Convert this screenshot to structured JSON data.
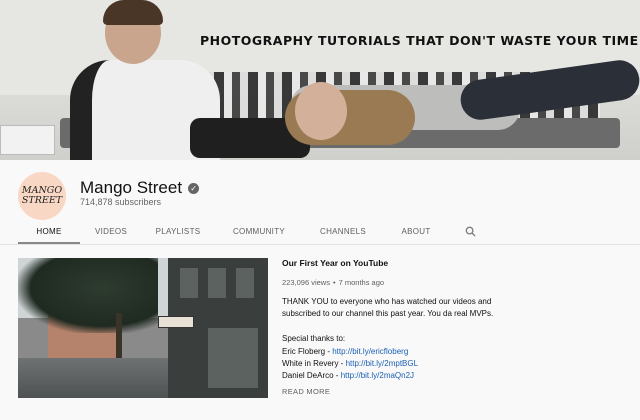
{
  "banner": {
    "tagline": "PHOTOGRAPHY TUTORIALS THAT DON'T WASTE YOUR TIME"
  },
  "channel": {
    "avatar_line1": "MANGO",
    "avatar_line2": "STREET",
    "name": "Mango Street",
    "verified_icon": "check-circle-icon",
    "subscribers": "714,878 subscribers"
  },
  "tabs": [
    {
      "label": "HOME",
      "active": true
    },
    {
      "label": "VIDEOS",
      "active": false
    },
    {
      "label": "PLAYLISTS",
      "active": false
    },
    {
      "label": "COMMUNITY",
      "active": false
    },
    {
      "label": "CHANNELS",
      "active": false
    },
    {
      "label": "ABOUT",
      "active": false
    }
  ],
  "featured_video": {
    "title": "Our First Year on YouTube",
    "views": "223,096 views",
    "separator": "•",
    "age": "7 months ago",
    "description": "THANK YOU to everyone who has watched our videos and subscribed to our channel this past year. You da real MVPs.",
    "thanks_heading": "Special thanks to:",
    "credits": [
      {
        "name": "Eric Floberg - ",
        "link": "http://bit.ly/ericfloberg"
      },
      {
        "name": "White in Revery - ",
        "link": "http://bit.ly/2mptBGL"
      },
      {
        "name": "Daniel DeArco - ",
        "link": "http://bit.ly/2maQn2J"
      }
    ],
    "read_more": "READ MORE"
  },
  "colors": {
    "link": "#1a5fb4",
    "tab_active": "#111111",
    "tab_inactive": "#606060"
  }
}
